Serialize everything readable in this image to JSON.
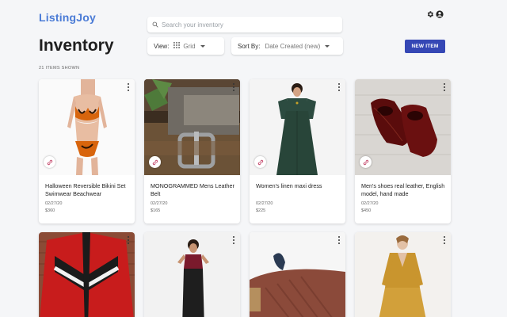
{
  "app": {
    "name": "ListingJoy"
  },
  "search": {
    "placeholder": "Search your inventory"
  },
  "page": {
    "title": "Inventory",
    "count": "21 ITEMS SHOWN"
  },
  "controls": {
    "view_label": "View:",
    "view_value": "Grid",
    "sort_label": "Sort By:",
    "sort_value": "Date Created (new)",
    "new_item": "NEW ITEM"
  },
  "icons": {
    "settings": "gear-icon",
    "account": "account-circle-icon",
    "search": "search-icon",
    "grid": "grid-icon",
    "link": "link-icon",
    "menu": "more-vert-icon"
  },
  "colors": {
    "brand": "#4a7bd6",
    "button": "#3547b5",
    "link": "#c44569"
  },
  "items": [
    {
      "title": "Halloween Reversible Bikini Set Swimwear Beachwear",
      "date": "02/27/20",
      "price": "$360"
    },
    {
      "title": "MONOGRAMMED Mens Leather Belt",
      "date": "02/27/20",
      "price": "$165"
    },
    {
      "title": "Women's linen maxi dress",
      "date": "02/27/20",
      "price": "$225"
    },
    {
      "title": "Men's shoes real leather, English model, hand made",
      "date": "02/27/20",
      "price": "$450"
    },
    {
      "title": "",
      "date": "",
      "price": ""
    },
    {
      "title": "",
      "date": "",
      "price": ""
    },
    {
      "title": "",
      "date": "",
      "price": ""
    },
    {
      "title": "",
      "date": "",
      "price": ""
    }
  ]
}
